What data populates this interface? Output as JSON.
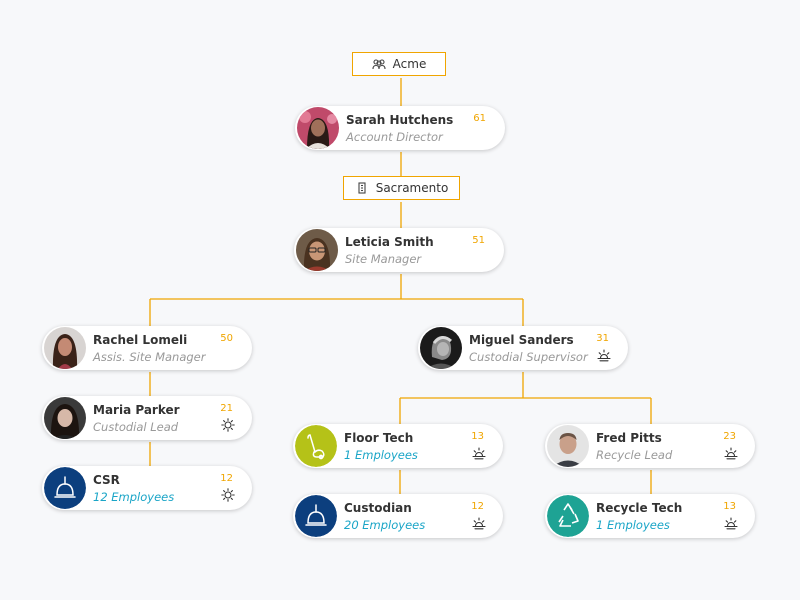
{
  "org": {
    "root_label": "Acme",
    "root_icon": "group-icon",
    "location_label": "Sacramento",
    "location_icon": "building-icon"
  },
  "colors": {
    "connector": "#f0a500",
    "accent_text": "#1aa5c7",
    "csr_icon_bg": "#0c3f7e",
    "floor_tech_icon_bg": "#b5c218",
    "recycle_icon_bg": "#1ea394"
  },
  "cards": {
    "sarah": {
      "name": "Sarah Hutchens",
      "role": "Account Director",
      "count": "61"
    },
    "leticia": {
      "name": "Leticia Smith",
      "role": "Site Manager",
      "count": "51"
    },
    "rachel": {
      "name": "Rachel Lomeli",
      "role": "Assis. Site Manager",
      "count": "50"
    },
    "miguel": {
      "name": "Miguel Sanders",
      "role": "Custodial Supervisor",
      "count": "31",
      "shift_icon": "sunrise-icon"
    },
    "maria": {
      "name": "Maria Parker",
      "role": "Custodial Lead",
      "count": "21",
      "shift_icon": "sun-icon"
    },
    "csr": {
      "name": "CSR",
      "role": "12 Employees",
      "count": "12",
      "shift_icon": "sun-icon"
    },
    "floor_tech": {
      "name": "Floor Tech",
      "role": "1 Employees",
      "count": "13",
      "shift_icon": "sunrise-icon"
    },
    "custodian": {
      "name": "Custodian",
      "role": "20 Employees",
      "count": "12",
      "shift_icon": "sunrise-icon"
    },
    "fred": {
      "name": "Fred Pitts",
      "role": "Recycle Lead",
      "count": "23",
      "shift_icon": "sunrise-icon"
    },
    "recycle_tech": {
      "name": "Recycle Tech",
      "role": "1 Employees",
      "count": "13",
      "shift_icon": "sunrise-icon"
    }
  }
}
